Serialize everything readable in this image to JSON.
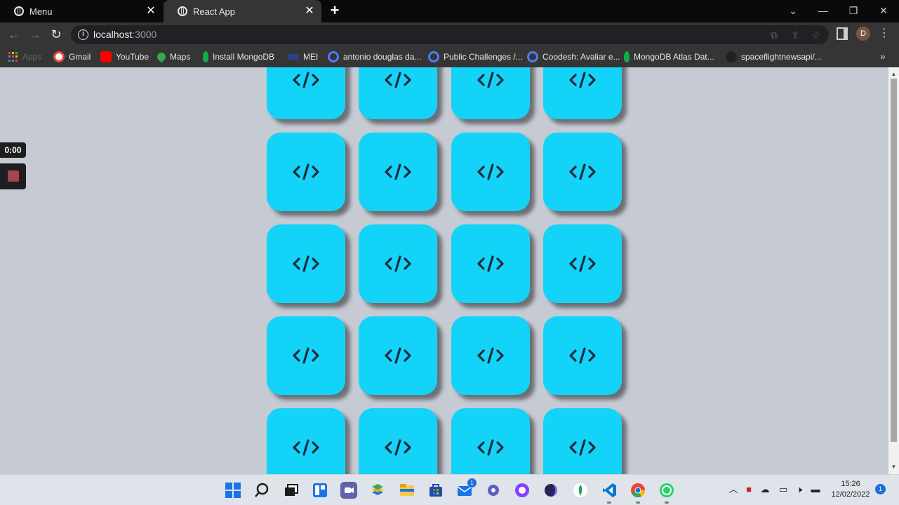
{
  "browser": {
    "tabs": [
      {
        "title": "Menu",
        "active": false
      },
      {
        "title": "React App",
        "active": true
      }
    ],
    "new_tab": "+",
    "url": {
      "host": "localhost",
      "port": ":3000"
    },
    "profile_initial": "D",
    "bookmarks": [
      {
        "label": "Apps"
      },
      {
        "label": "Gmail"
      },
      {
        "label": "YouTube"
      },
      {
        "label": "Maps"
      },
      {
        "label": "Install MongoDB"
      },
      {
        "label": "MEI"
      },
      {
        "label": "antonio douglas da..."
      },
      {
        "label": "Public Challenges /..."
      },
      {
        "label": "Coodesh: Avaliar e..."
      },
      {
        "label": "MongoDB Atlas Dat..."
      },
      {
        "label": "spaceflightnewsapi/..."
      }
    ],
    "bookmarks_overflow": "»"
  },
  "page": {
    "card_icon": "code-icon",
    "card_color": "#14d3f8",
    "rows": 5,
    "columns": 4
  },
  "recorder": {
    "time": "0:00",
    "stop_color": "#a5454f"
  },
  "taskbar": {
    "apps": [
      {
        "name": "start-icon"
      },
      {
        "name": "search-icon"
      },
      {
        "name": "task-view-icon"
      },
      {
        "name": "widgets-icon"
      },
      {
        "name": "chat-icon"
      },
      {
        "name": "bluestacks-icon"
      },
      {
        "name": "file-explorer-icon"
      },
      {
        "name": "store-icon"
      },
      {
        "name": "mail-icon",
        "badge": "1"
      },
      {
        "name": "settings-icon"
      },
      {
        "name": "github-icon"
      },
      {
        "name": "eclipse-icon"
      },
      {
        "name": "mongodb-compass-icon"
      },
      {
        "name": "vscode-icon"
      },
      {
        "name": "chrome-icon"
      },
      {
        "name": "whatsapp-icon"
      }
    ],
    "time": "15:26",
    "date": "12/02/2022",
    "notifications": "1"
  }
}
